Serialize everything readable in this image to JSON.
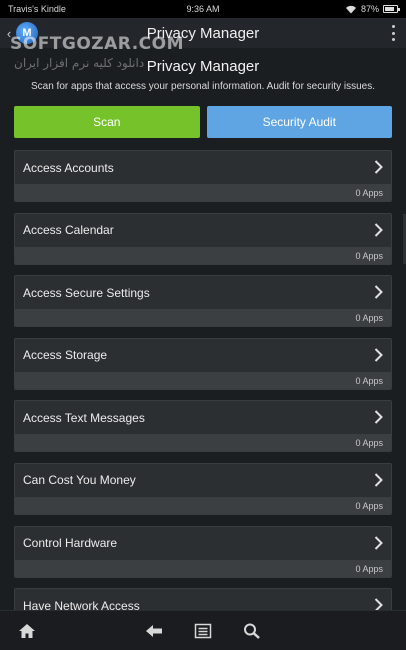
{
  "status_bar": {
    "device": "Travis's Kindle",
    "time": "9:36 AM",
    "battery": "87%"
  },
  "action_bar": {
    "title": "Privacy Manager"
  },
  "watermark": {
    "text": "SOFTGOZAR.COM",
    "sub": "دانلود کلیه نرم افزار ایران"
  },
  "header": {
    "title": "Privacy Manager",
    "subtitle": "Scan for apps that access your personal information. Audit for security issues."
  },
  "buttons": {
    "scan": "Scan",
    "audit": "Security Audit"
  },
  "colors": {
    "scan": "#76c22a",
    "audit": "#5fa5e3"
  },
  "list": [
    {
      "label": "Access Accounts",
      "count": "0 Apps"
    },
    {
      "label": "Access Calendar",
      "count": "0 Apps"
    },
    {
      "label": "Access Secure Settings",
      "count": "0 Apps"
    },
    {
      "label": "Access Storage",
      "count": "0 Apps"
    },
    {
      "label": "Access Text Messages",
      "count": "0 Apps"
    },
    {
      "label": "Can Cost You Money",
      "count": "0 Apps"
    },
    {
      "label": "Control Hardware",
      "count": "0 Apps"
    },
    {
      "label": "Have Network Access",
      "count": ""
    }
  ],
  "nav": [
    "home-icon",
    "back-arrow-icon",
    "menu-icon",
    "search-icon"
  ]
}
